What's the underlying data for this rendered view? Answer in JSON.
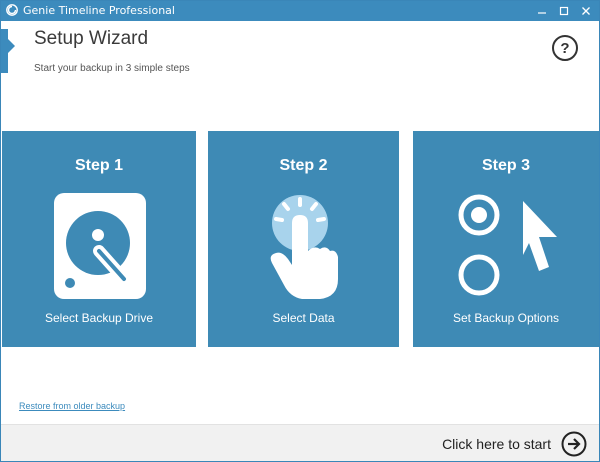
{
  "window": {
    "title": "Genie Timeline Professional"
  },
  "header": {
    "title": "Setup Wizard",
    "subtitle": "Start your backup in 3 simple steps",
    "help_label": "?"
  },
  "steps": [
    {
      "heading": "Step 1",
      "label": "Select Backup Drive",
      "icon": "hard-drive-icon"
    },
    {
      "heading": "Step 2",
      "label": "Select Data",
      "icon": "touch-hand-icon"
    },
    {
      "heading": "Step 3",
      "label": "Set Backup Options",
      "icon": "options-cursor-icon"
    }
  ],
  "footer": {
    "restore_link": "Restore from older backup",
    "start_label": "Click here to start"
  },
  "colors": {
    "accent": "#3c8bbd",
    "tile": "#3e8ab5",
    "footer_bg": "#f1f1f1"
  }
}
